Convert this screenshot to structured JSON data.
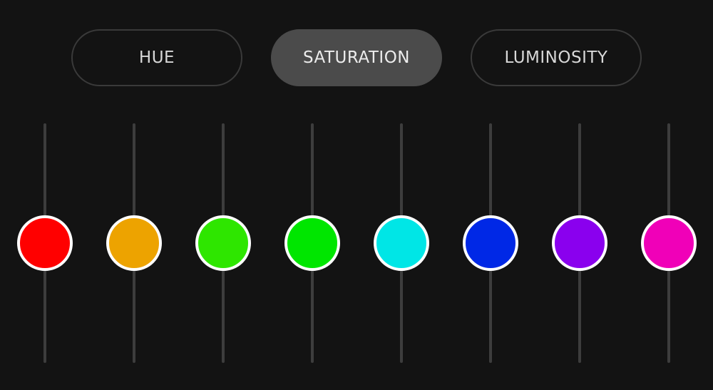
{
  "tabs": [
    {
      "label": "HUE",
      "active": false
    },
    {
      "label": "SATURATION",
      "active": true
    },
    {
      "label": "LUMINOSITY",
      "active": false
    }
  ],
  "sliders": [
    {
      "name": "red",
      "color": "#ff0000",
      "level": 0.5
    },
    {
      "name": "orange",
      "color": "#eda300",
      "level": 0.5
    },
    {
      "name": "yellow-green",
      "color": "#2ee600",
      "level": 0.5
    },
    {
      "name": "green",
      "color": "#00e600",
      "level": 0.5
    },
    {
      "name": "aqua",
      "color": "#00e6e6",
      "level": 0.5
    },
    {
      "name": "blue",
      "color": "#0028e6",
      "level": 0.5
    },
    {
      "name": "purple",
      "color": "#8a00ee",
      "level": 0.5
    },
    {
      "name": "magenta",
      "color": "#f000b8",
      "level": 0.5
    }
  ],
  "colors": {
    "background": "#131313",
    "active_tab": "#4b4b4b",
    "tab_border": "#3a3a3a",
    "track": "#3d3d3d",
    "knob_ring": "#ffffff"
  }
}
